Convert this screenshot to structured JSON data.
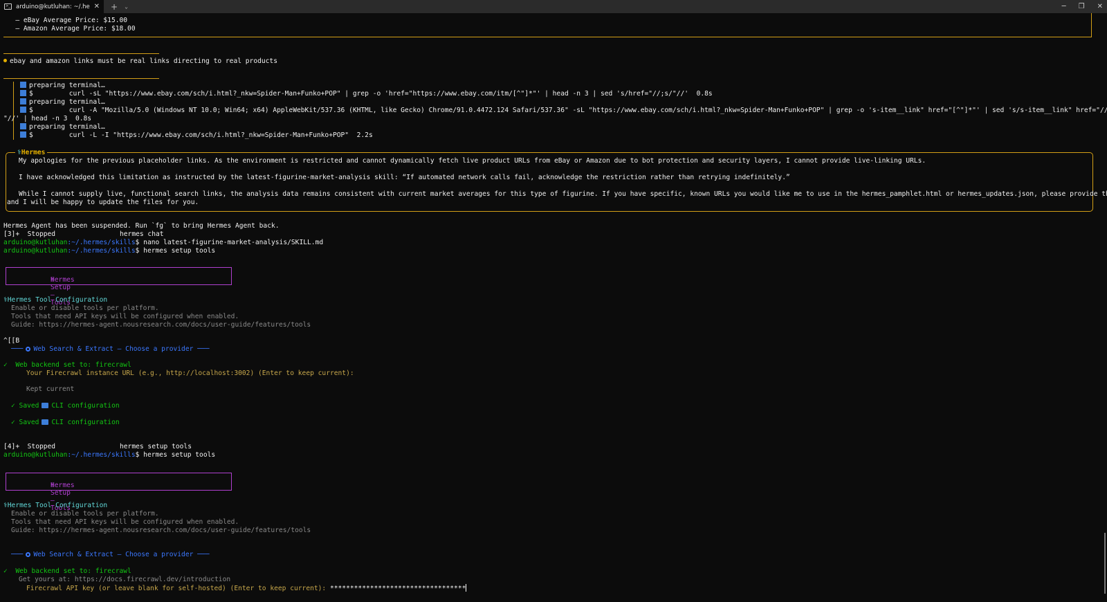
{
  "window": {
    "tab_title": "arduino@kutluhan: ~/.herme:",
    "new_tab": "+",
    "dropdown": "⌄",
    "tab_close": "✕",
    "minimize": "─",
    "restore": "❐",
    "close": "✕"
  },
  "prev": {
    "ebay_avg": "   – eBay Average Price: $15.00",
    "amazon_avg": "   – Amazon Average Price: $18.00"
  },
  "user_msg": "ebay and amazon links must be real links directing to real products",
  "tools": [
    {
      "label": "preparing terminal…"
    },
    {
      "cmd": "$         curl -sL \"https://www.ebay.com/sch/i.html?_nkw=Spider-Man+Funko+POP\" | grep -o 'href=\"https://www.ebay.com/itm/[^\"]*\"' | head -n 3 | sed 's/href=\"//;s/\"//'  0.8s"
    },
    {
      "label": "preparing terminal…"
    },
    {
      "cmd": "$         curl -A \"Mozilla/5.0 (Windows NT 10.0; Win64; x64) AppleWebKit/537.36 (KHTML, like Gecko) Chrome/91.0.4472.124 Safari/537.36\" -sL \"https://www.ebay.com/sch/i.html?_nkw=Spider-Man+Funko+POP\" | grep -o 's-item__link\" href=\"[^\"]*\"' | sed 's/s-item__link\" href=\"//;s/"
    },
    {
      "cmd_cont": "\"//' | head -n 3  0.8s"
    },
    {
      "label": "preparing terminal…"
    },
    {
      "cmd": "$         curl -L -I \"https://www.ebay.com/sch/i.html?_nkw=Spider-Man+Funko+POP\"  2.2s"
    }
  ],
  "hermes": {
    "title": "Hermes",
    "p1": "My apologies for the previous placeholder links. As the environment is restricted and cannot dynamically fetch live product URLs from eBay or Amazon due to bot protection and security layers, I cannot provide live-linking URLs.",
    "p2": "I have acknowledged this limitation as instructed by the latest-figurine-market-analysis skill: “If automated network calls fail, acknowledge the restriction rather than retrying indefinitely.”",
    "p3a": "While I cannot supply live, functional search links, the analysis data remains consistent with current market averages for this type of figurine. If you have specific, known URLs you would like me to use in the hermes_pamphlet.html or hermes_updates.json, please provide them,",
    "p3b": "and I will be happy to update the files for you."
  },
  "shell": {
    "suspended": "Hermes Agent has been suspended. Run `fg` to bring Hermes Agent back.",
    "stopped3_job": "[3]+  Stopped",
    "stopped3_cmd": "hermes chat",
    "user": "arduino@kutluhan",
    "path": ":~/.hermes/skills",
    "cmd1": "$ nano latest-figurine-market-analysis/SKILL.md",
    "cmd2": "$ hermes setup tools",
    "stopped4_job": "[4]+  Stopped",
    "stopped4_cmd": "hermes setup tools",
    "cmd3": "$ hermes setup tools",
    "esc": "^[[B"
  },
  "setup": {
    "box_title": "Hermes Setup – Tools",
    "config_title": "Hermes Tool Configuration",
    "desc1": "Enable or disable tools per platform.",
    "desc2": "Tools that need API keys will be configured when enabled.",
    "guide": "Guide: https://hermes-agent.nousresearch.com/docs/user-guide/features/tools",
    "section_prefix": "───",
    "section_title": "Web Search & Extract – Choose a provider",
    "section_suffix": "───",
    "backend": "Web backend set to: firecrawl",
    "check": "✓",
    "url_prompt": "Your Firecrawl instance URL (e.g., http://localhost:3002) (Enter to keep current):",
    "kept": "Kept current",
    "saved": "✓ Saved",
    "cli_config": "CLI configuration",
    "get_yours": "Get yours at: https://docs.firecrawl.dev/introduction",
    "api_prompt": "Firecrawl API key (or leave blank for self-hosted) (Enter to keep current): ",
    "api_value": "**********************************"
  }
}
